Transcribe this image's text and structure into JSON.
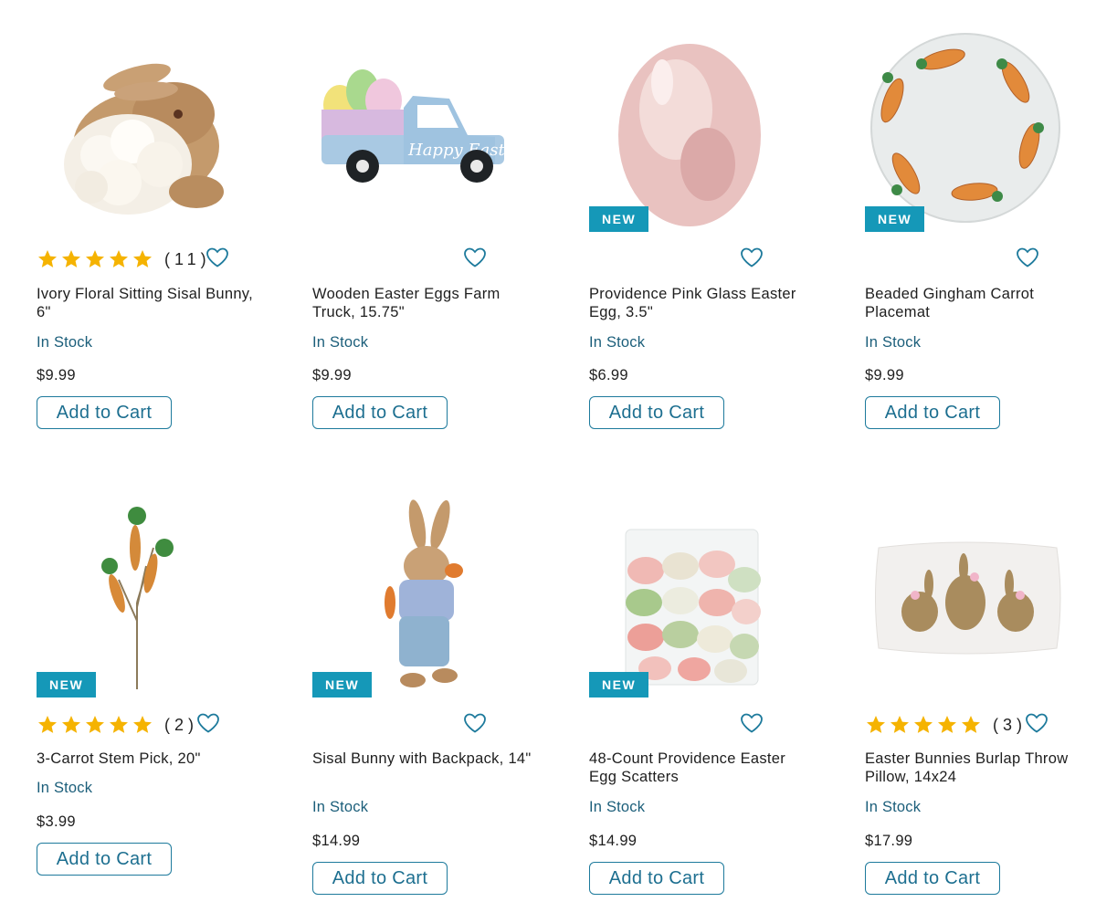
{
  "colors": {
    "accent": "#1598b8",
    "stock": "#1b5e7a",
    "button_border": "#1d7a9c",
    "star": "#f5b301"
  },
  "products": [
    {
      "title": "Ivory Floral Sitting Sisal Bunny, 6\"",
      "stock": "In Stock",
      "price": "$9.99",
      "rating": 5,
      "review_count": "(11)",
      "badge": "",
      "cart_label": "Add to Cart",
      "image": "sisal-bunny-image"
    },
    {
      "title": "Wooden Easter Eggs Farm Truck, 15.75\"",
      "stock": "In Stock",
      "price": "$9.99",
      "rating": null,
      "review_count": "",
      "badge": "",
      "cart_label": "Add to Cart",
      "image": "easter-truck-image",
      "image_text": "Happy Easter"
    },
    {
      "title": "Providence Pink Glass Easter Egg, 3.5\"",
      "stock": "In Stock",
      "price": "$6.99",
      "rating": null,
      "review_count": "",
      "badge": "NEW",
      "cart_label": "Add to Cart",
      "image": "pink-egg-image"
    },
    {
      "title": "Beaded Gingham Carrot Placemat",
      "stock": "In Stock",
      "price": "$9.99",
      "rating": null,
      "review_count": "",
      "badge": "NEW",
      "cart_label": "Add to Cart",
      "image": "carrot-placemat-image"
    },
    {
      "title": "3-Carrot Stem Pick, 20\"",
      "stock": "In Stock",
      "price": "$3.99",
      "rating": 5,
      "review_count": "(2)",
      "badge": "NEW",
      "cart_label": "Add to Cart",
      "image": "carrot-pick-image"
    },
    {
      "title": "Sisal Bunny with Backpack, 14\"",
      "stock": "In Stock",
      "price": "$14.99",
      "rating": null,
      "review_count": "",
      "badge": "NEW",
      "cart_label": "Add to Cart",
      "image": "backpack-bunny-image"
    },
    {
      "title": "48-Count Providence Easter Egg Scatters",
      "stock": "In Stock",
      "price": "$14.99",
      "rating": null,
      "review_count": "",
      "badge": "NEW",
      "cart_label": "Add to Cart",
      "image": "egg-scatters-image"
    },
    {
      "title": "Easter Bunnies Burlap Throw Pillow, 14x24",
      "stock": "In Stock",
      "price": "$17.99",
      "rating": 5,
      "review_count": "(3)",
      "badge": "",
      "cart_label": "Add to Cart",
      "image": "bunny-pillow-image"
    }
  ]
}
